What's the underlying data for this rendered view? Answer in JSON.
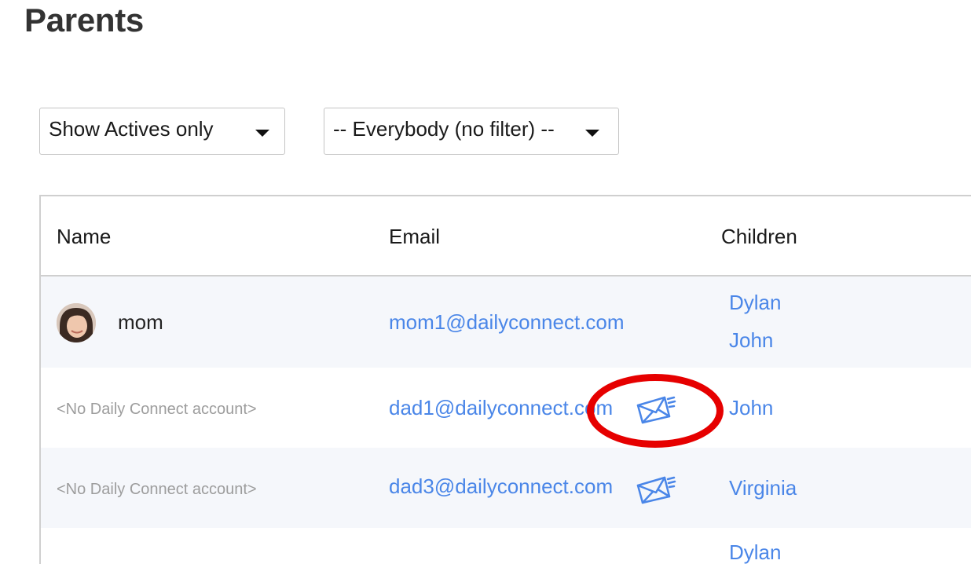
{
  "page": {
    "title": "Parents"
  },
  "filters": {
    "status": {
      "selected": "Show Actives only"
    },
    "group": {
      "selected": "-- Everybody (no filter) --"
    }
  },
  "table": {
    "headers": {
      "name": "Name",
      "email": "Email",
      "children": "Children"
    },
    "rows": [
      {
        "name": "mom",
        "has_avatar": true,
        "email": "mom1@dailyconnect.com",
        "invite_icon": false,
        "children": [
          "Dylan",
          "John"
        ]
      },
      {
        "name": "<No Daily Connect account>",
        "has_avatar": false,
        "email": "dad1@dailyconnect.com",
        "invite_icon": true,
        "children": [
          "John"
        ]
      },
      {
        "name": "<No Daily Connect account>",
        "has_avatar": false,
        "email": "dad3@dailyconnect.com",
        "invite_icon": true,
        "children": [
          "Virginia"
        ]
      },
      {
        "name": "",
        "has_avatar": false,
        "email": "",
        "invite_icon": false,
        "children": [
          "Dylan"
        ]
      }
    ]
  },
  "icons": {
    "invite": "send-email-icon",
    "dropdown": "chevron-down-icon",
    "annotation": "red-circle-highlight"
  },
  "colors": {
    "link": "#4a86e8",
    "row_shade": "#f5f7fb",
    "highlight": "#e60000",
    "muted": "#9d9d9d"
  }
}
